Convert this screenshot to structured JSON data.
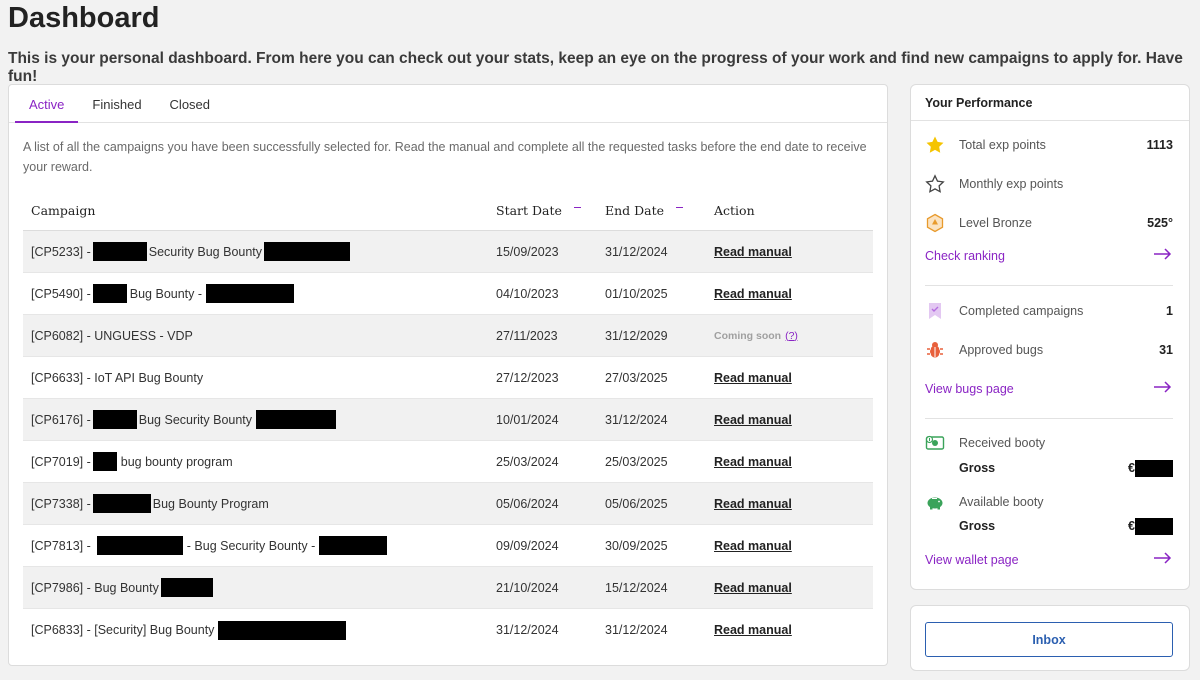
{
  "page": {
    "title": "Dashboard",
    "subtitle": "This is your personal dashboard. From here you can check out your stats, keep an eye on the progress of your work and find new campaigns to apply for. Have fun!"
  },
  "tabs": [
    {
      "label": "Active",
      "active": true
    },
    {
      "label": "Finished",
      "active": false
    },
    {
      "label": "Closed",
      "active": false
    }
  ],
  "campaigns": {
    "description": "A list of all the campaigns you have been successfully selected for. Read the manual and complete all the requested tasks before the end date to receive your reward.",
    "columns": {
      "campaign": "Campaign",
      "start_date": "Start Date",
      "end_date": "End Date",
      "action": "Action"
    },
    "action_label": "Read manual",
    "coming_soon_label": "Coming soon",
    "help_label": "(?)",
    "rows": [
      {
        "code": "[CP5233] -",
        "name": "Security Bug Bounty",
        "start": "15/09/2023",
        "end": "31/12/2024",
        "action": "read"
      },
      {
        "code": "[CP5490] -",
        "name": "Bug Bounty -",
        "start": "04/10/2023",
        "end": "01/10/2025",
        "action": "read"
      },
      {
        "code": "[CP6082] - UNGUESS - VDP",
        "name": "",
        "start": "27/11/2023",
        "end": "31/12/2029",
        "action": "coming"
      },
      {
        "code": "[CP6633] - IoT API Bug Bounty",
        "name": "",
        "start": "27/12/2023",
        "end": "27/03/2025",
        "action": "read"
      },
      {
        "code": "[CP6176] -",
        "name": "Bug Security Bounty",
        "start": "10/01/2024",
        "end": "31/12/2024",
        "action": "read"
      },
      {
        "code": "[CP7019] -",
        "name": "bug bounty program",
        "start": "25/03/2024",
        "end": "25/03/2025",
        "action": "read"
      },
      {
        "code": "[CP7338] -",
        "name": "Bug Bounty Program",
        "start": "05/06/2024",
        "end": "05/06/2025",
        "action": "read"
      },
      {
        "code": "[CP7813] -",
        "name": "- Bug Security Bounty -",
        "start": "09/09/2024",
        "end": "30/09/2025",
        "action": "read"
      },
      {
        "code": "[CP7986] - Bug Bounty",
        "name": "",
        "start": "21/10/2024",
        "end": "15/12/2024",
        "action": "read"
      },
      {
        "code": "[CP6833] - [Security] Bug Bounty",
        "name": "",
        "start": "31/12/2024",
        "end": "31/12/2024",
        "action": "read"
      }
    ]
  },
  "performance": {
    "title": "Your Performance",
    "total_exp": {
      "label": "Total exp points",
      "value": "1113"
    },
    "monthly_exp": {
      "label": "Monthly exp points",
      "value": ""
    },
    "level": {
      "label": "Level Bronze",
      "value": "525°"
    },
    "check_ranking": "Check ranking",
    "completed": {
      "label": "Completed campaigns",
      "value": "1"
    },
    "approved_bugs": {
      "label": "Approved bugs",
      "value": "31"
    },
    "view_bugs": "View bugs page",
    "received_booty": {
      "label": "Received booty",
      "gross_label": "Gross",
      "currency": "€"
    },
    "available_booty": {
      "label": "Available booty",
      "gross_label": "Gross",
      "currency": "€"
    },
    "view_wallet": "View wallet page",
    "colors": {
      "accent": "#8a24c4",
      "star": "#f5c400",
      "level": "#e89a2c",
      "bug": "#e8603c",
      "booty": "#3aa35a"
    }
  },
  "inbox": {
    "label": "Inbox"
  }
}
